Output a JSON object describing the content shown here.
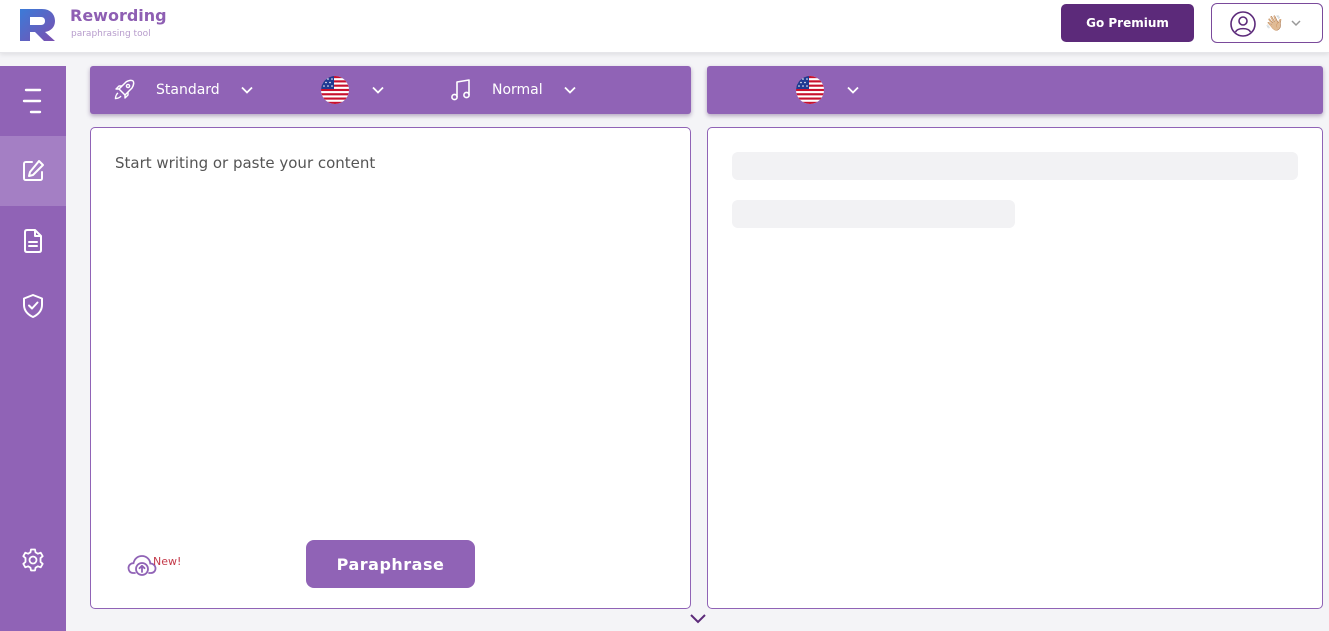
{
  "header": {
    "brand_name": "Rewording",
    "brand_sub": "paraphrasing tool",
    "premium_label": "Go Premium",
    "user_emoji": "👋🏼"
  },
  "sidebar": {
    "items": [
      {
        "icon": "menu-icon"
      },
      {
        "icon": "edit-icon",
        "active": true
      },
      {
        "icon": "document-icon"
      },
      {
        "icon": "shield-check-icon"
      },
      {
        "icon": "gear-icon"
      }
    ]
  },
  "toolbar": {
    "mode_label": "Standard",
    "tone_label": "Normal",
    "input_language_flag": "us-flag-icon",
    "output_language_flag": "us-flag-icon"
  },
  "editor": {
    "placeholder": "Start writing or paste your content",
    "new_badge": "New!",
    "paraphrase_label": "Paraphrase"
  },
  "colors": {
    "primary": "#9063b6",
    "dark_primary": "#5c2a7a",
    "active_side": "#a47fc4",
    "new_badge": "#c43a4a"
  }
}
